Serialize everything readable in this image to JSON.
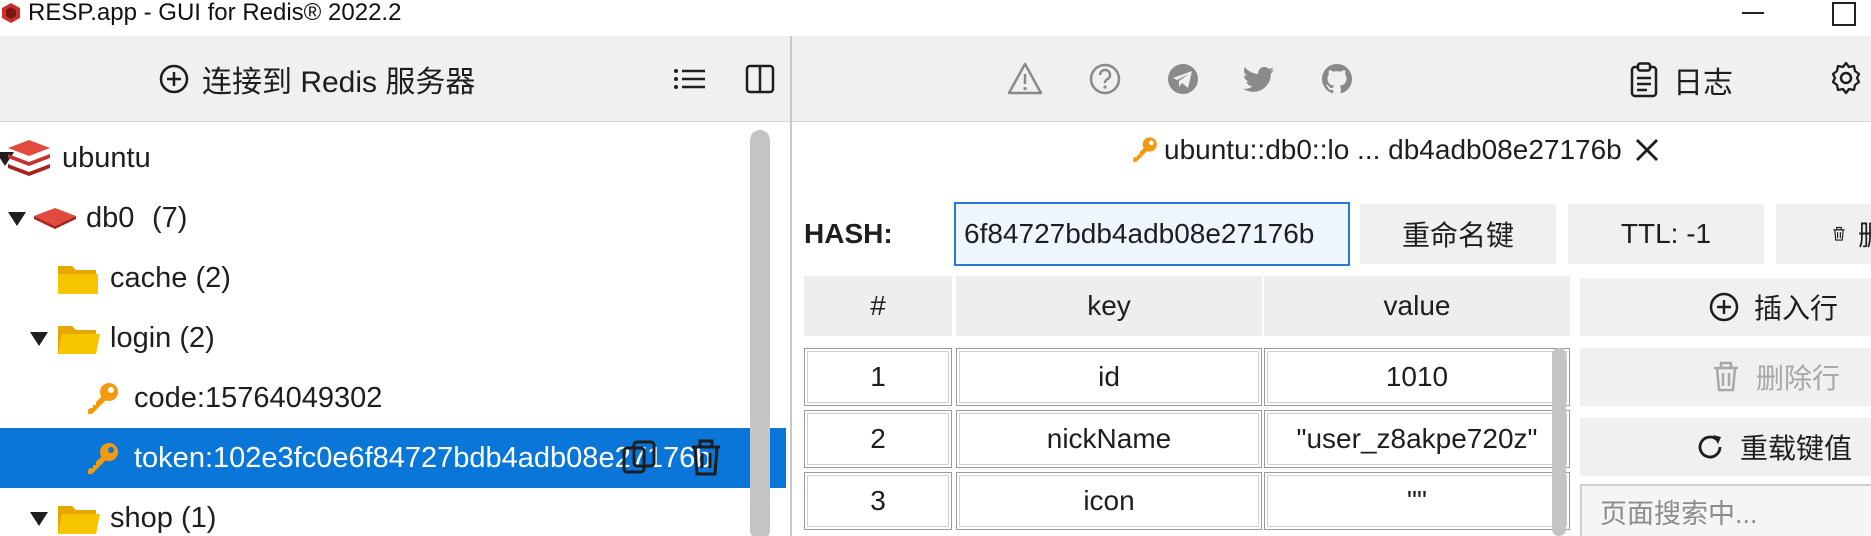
{
  "window": {
    "title": "RESP.app - GUI for Redis® 2022.2"
  },
  "left_toolbar": {
    "connect_label": "连接到 Redis 服务器"
  },
  "right_toolbar": {
    "logs_label": "日志"
  },
  "tree": {
    "server": {
      "label": "ubuntu"
    },
    "db": {
      "label": "db0",
      "count": "(7)"
    },
    "folders": [
      {
        "label": "cache (2)"
      },
      {
        "label": "login (2)"
      },
      {
        "label": "shop (1)"
      }
    ],
    "keys": [
      {
        "label": "code:15764049302"
      },
      {
        "label": "token:102e3fc0e6f84727bdb4adb08e27176b"
      }
    ]
  },
  "key_tab": {
    "title": "ubuntu::db0::lo ... db4adb08e27176b"
  },
  "key_view": {
    "type_label": "HASH:",
    "key_name": "6f84727bdb4adb08e27176b",
    "rename_label": "重命名键",
    "ttl_label": "TTL: -1",
    "delete_label": "删"
  },
  "table": {
    "headers": [
      "#",
      "key",
      "value"
    ],
    "rows": [
      {
        "num": "1",
        "key": "id",
        "value": "1010"
      },
      {
        "num": "2",
        "key": "nickName",
        "value": "\"user_z8akpe720z\""
      },
      {
        "num": "3",
        "key": "icon",
        "value": "\"\""
      }
    ]
  },
  "actions": {
    "insert_row": "插入行",
    "delete_row": "删除行",
    "reload": "重载键值",
    "search_placeholder": "页面搜索中..."
  },
  "colors": {
    "selection": "#0a77d8",
    "key_icon": "#f29a0e",
    "folder": "#f7c400",
    "redis_red": "#c9302c"
  }
}
